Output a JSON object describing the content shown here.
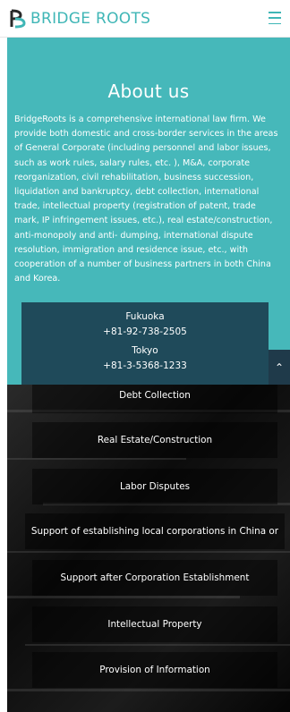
{
  "header": {
    "brand": "BRIDGE ROOTS",
    "logo_icon": "br-logo-icon",
    "menu_icon": "hamburger-icon"
  },
  "about": {
    "title": "About us",
    "body": "BridgeRoots is a comprehensive international law firm. We provide both domestic and cross-border services in the areas of General Corporate (including personnel and labor issues, such as work rules, salary rules, etc. ), M&A, corporate reorganization, civil rehabilitation, business succession, liquidation and bankruptcy, debt collection, international trade, intellectual property (registration of patent, trade mark, IP infringement issues, etc.), real estate/construction, anti-monopoly and anti- dumping, international dispute resolution, immigration and residence issue, etc., with cooperation of a number of business partners in both China and Korea."
  },
  "offices": [
    {
      "city": "Fukuoka",
      "phone": "+81-92-738-2505"
    },
    {
      "city": "Tokyo",
      "phone": "+81-3-5368-1233"
    }
  ],
  "scroll_top_icon": "chevron-up-icon",
  "services": [
    "Debt Collection",
    "Real Estate/Construction",
    "Labor Disputes",
    "Support of establishing local corporations in China or",
    "Support after Corporation Establishment",
    "Intellectual Property",
    "Provision of Information"
  ],
  "colors": {
    "brand": "#3fb6b6",
    "about_bg": "#46b8ba",
    "offices_bg": "#1f4a5a"
  }
}
